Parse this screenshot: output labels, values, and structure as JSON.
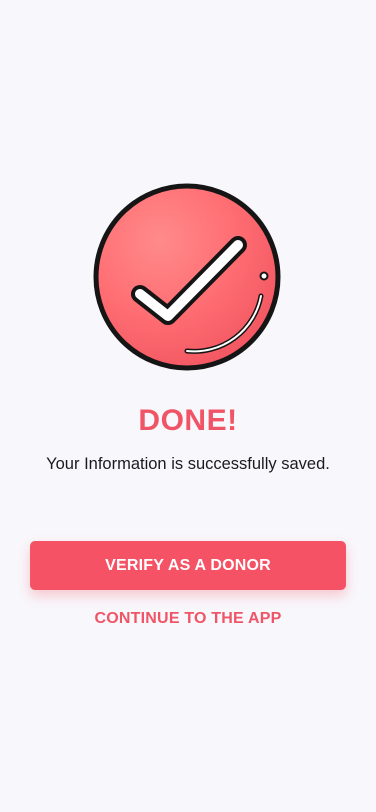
{
  "success": {
    "icon": "check-circle-icon",
    "title": "DONE!",
    "message": "Your Information is successfully saved."
  },
  "actions": {
    "primary_label": "VERIFY AS A DONOR",
    "secondary_label": "CONTINUE TO THE APP"
  },
  "colors": {
    "accent": "#f55266",
    "accent_text": "#ef5567",
    "background": "#f8f7fb",
    "text": "#1b1b1f"
  }
}
